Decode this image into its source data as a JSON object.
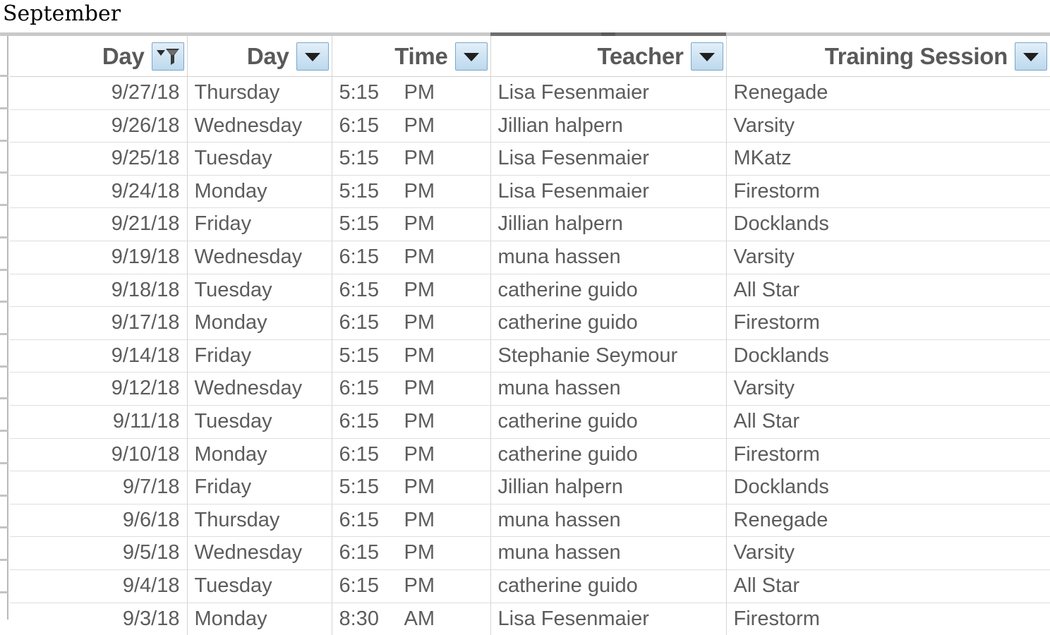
{
  "sheet": {
    "title": "September"
  },
  "colors": {
    "header_text": "#595959",
    "cell_text": "#5c5c5c",
    "grid_line": "#d4d4d4",
    "filter_button_border": "#7aa6cc",
    "filter_button_fill": "#bcd9ed",
    "selection_rule": "#6e6e6e"
  },
  "table": {
    "columns": [
      {
        "label": "Day",
        "key": "date",
        "filter": "filter-funnel-icon",
        "filtered": true
      },
      {
        "label": "Day",
        "key": "day",
        "filter": "chevron-down-icon",
        "filtered": false
      },
      {
        "label": "Time",
        "key": "time",
        "filter": "chevron-down-icon",
        "filtered": false
      },
      {
        "label": "Teacher",
        "key": "teacher",
        "filter": "chevron-down-icon",
        "filtered": false
      },
      {
        "label": "Training Session",
        "key": "session",
        "filter": "chevron-down-icon",
        "filtered": false
      }
    ],
    "rows": [
      {
        "date": "9/27/18",
        "day": "Thursday",
        "time_hhmm": "5:15",
        "time_mer": "PM",
        "teacher": "Lisa Fesenmaier",
        "session": "Renegade"
      },
      {
        "date": "9/26/18",
        "day": "Wednesday",
        "time_hhmm": "6:15",
        "time_mer": "PM",
        "teacher": "Jillian halpern",
        "session": "Varsity"
      },
      {
        "date": "9/25/18",
        "day": "Tuesday",
        "time_hhmm": "5:15",
        "time_mer": "PM",
        "teacher": "Lisa Fesenmaier",
        "session": "MKatz"
      },
      {
        "date": "9/24/18",
        "day": "Monday",
        "time_hhmm": "5:15",
        "time_mer": "PM",
        "teacher": "Lisa Fesenmaier",
        "session": "Firestorm"
      },
      {
        "date": "9/21/18",
        "day": "Friday",
        "time_hhmm": "5:15",
        "time_mer": "PM",
        "teacher": "Jillian halpern",
        "session": "Docklands"
      },
      {
        "date": "9/19/18",
        "day": "Wednesday",
        "time_hhmm": "6:15",
        "time_mer": "PM",
        "teacher": "muna hassen",
        "session": "Varsity"
      },
      {
        "date": "9/18/18",
        "day": "Tuesday",
        "time_hhmm": "6:15",
        "time_mer": "PM",
        "teacher": "catherine guido",
        "session": "All Star"
      },
      {
        "date": "9/17/18",
        "day": "Monday",
        "time_hhmm": "6:15",
        "time_mer": "PM",
        "teacher": "catherine guido",
        "session": "Firestorm"
      },
      {
        "date": "9/14/18",
        "day": "Friday",
        "time_hhmm": "5:15",
        "time_mer": "PM",
        "teacher": "Stephanie Seymour",
        "session": "Docklands"
      },
      {
        "date": "9/12/18",
        "day": "Wednesday",
        "time_hhmm": "6:15",
        "time_mer": "PM",
        "teacher": "muna hassen",
        "session": "Varsity"
      },
      {
        "date": "9/11/18",
        "day": "Tuesday",
        "time_hhmm": "6:15",
        "time_mer": "PM",
        "teacher": "catherine guido",
        "session": "All Star"
      },
      {
        "date": "9/10/18",
        "day": "Monday",
        "time_hhmm": "6:15",
        "time_mer": "PM",
        "teacher": "catherine guido",
        "session": "Firestorm"
      },
      {
        "date": "9/7/18",
        "day": "Friday",
        "time_hhmm": "5:15",
        "time_mer": "PM",
        "teacher": "Jillian halpern",
        "session": "Docklands"
      },
      {
        "date": "9/6/18",
        "day": "Thursday",
        "time_hhmm": "6:15",
        "time_mer": "PM",
        "teacher": "muna hassen",
        "session": "Renegade"
      },
      {
        "date": "9/5/18",
        "day": "Wednesday",
        "time_hhmm": "6:15",
        "time_mer": "PM",
        "teacher": "muna hassen",
        "session": "Varsity"
      },
      {
        "date": "9/4/18",
        "day": "Tuesday",
        "time_hhmm": "6:15",
        "time_mer": "PM",
        "teacher": "catherine guido",
        "session": "All Star"
      },
      {
        "date": "9/3/18",
        "day": "Monday",
        "time_hhmm": "8:30",
        "time_mer": "AM",
        "teacher": "Lisa Fesenmaier",
        "session": "Firestorm"
      }
    ]
  }
}
